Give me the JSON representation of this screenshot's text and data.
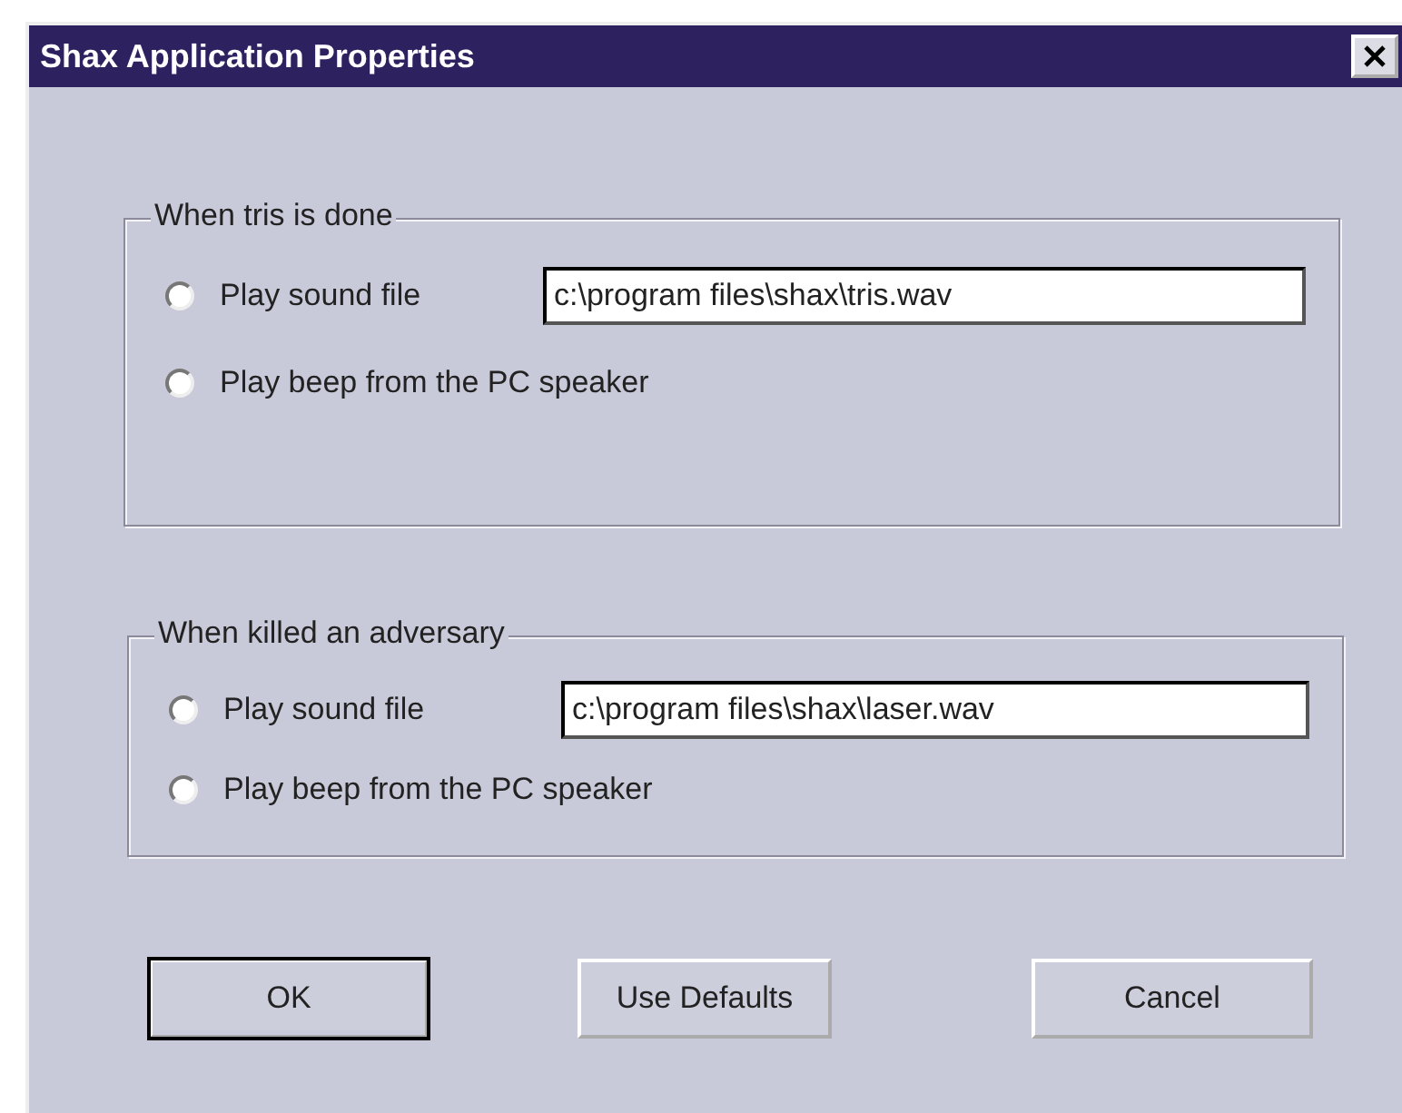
{
  "window": {
    "title": "Shax Application Properties"
  },
  "groups": [
    {
      "title": "When tris is done",
      "options": [
        {
          "label": "Play sound file",
          "selected": false,
          "kind": "file",
          "value": "c:\\program files\\shax\\tris.wav"
        },
        {
          "label": "Play beep from the PC speaker",
          "selected": false,
          "kind": "plain"
        }
      ]
    },
    {
      "title": "When killed an adversary",
      "options": [
        {
          "label": "Play sound file",
          "selected": false,
          "kind": "file",
          "value": "c:\\program files\\shax\\laser.wav"
        },
        {
          "label": "Play beep from the PC speaker",
          "selected": false,
          "kind": "plain"
        }
      ]
    }
  ],
  "buttons": [
    {
      "label": "OK",
      "default": true
    },
    {
      "label": "Use Defaults",
      "default": false
    },
    {
      "label": "Cancel",
      "default": false
    }
  ]
}
